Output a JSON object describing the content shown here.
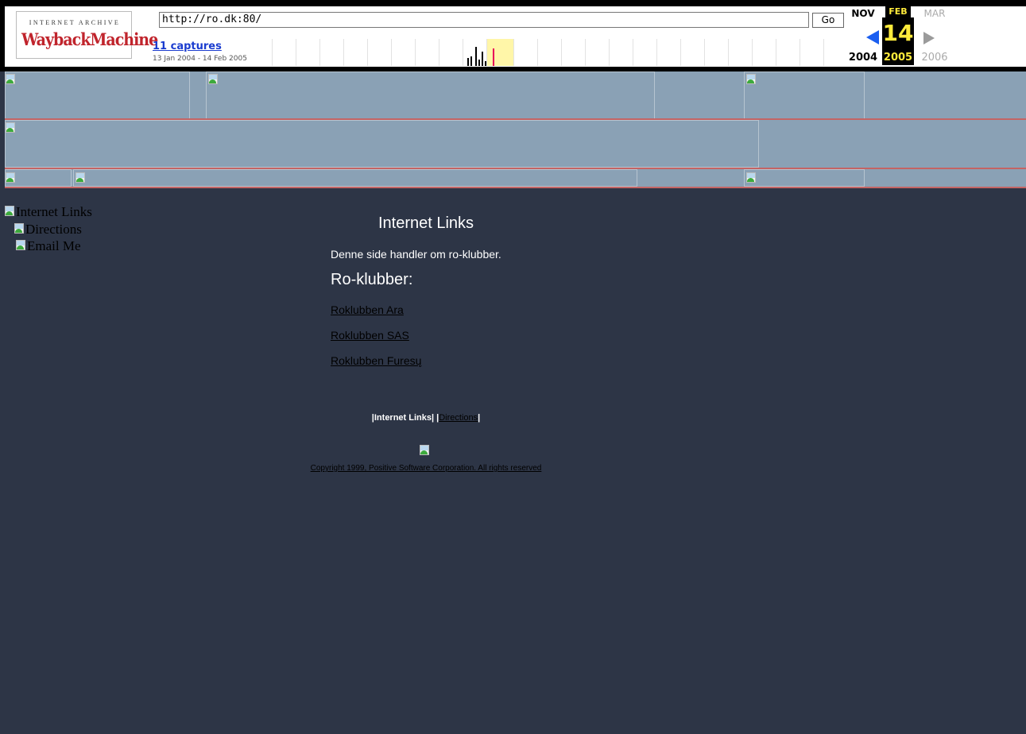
{
  "wayback": {
    "logo_top": "INTERNET ARCHIVE",
    "logo_main": "WaybackMachine",
    "url": "http://ro.dk:80/",
    "go_label": "Go",
    "captures_link": "11 captures",
    "captures_range": "13 Jan 2004 - 14 Feb 2005",
    "prev_month": "NOV",
    "current_month": "FEB",
    "next_month": "MAR",
    "current_day": "14",
    "prev_year": "2004",
    "current_year": "2005",
    "next_year": "2006"
  },
  "left_nav": {
    "items": [
      {
        "alt": "Internet Links"
      },
      {
        "alt": "Directions"
      },
      {
        "alt": "Email Me"
      }
    ]
  },
  "main": {
    "heading": "Internet Links",
    "intro": "Denne side handler om ro-klubber.",
    "clubs_heading": "Ro-klubber:",
    "clubs": [
      {
        "label": "Roklubben Ara"
      },
      {
        "label": "Roklubben SAS"
      },
      {
        "label": "Roklubben Furesų"
      }
    ]
  },
  "footer": {
    "sep_open": "|",
    "internet_links": "Internet Links",
    "sep_mid": "| |",
    "directions": "Directions",
    "sep_close": "|",
    "copyright": "Copyright 1999, Positive Software Corporation. All rights reserved"
  },
  "colors": {
    "page_bg": "#2d3546",
    "band_bg": "#8aa1b5",
    "band_line": "#c46464",
    "calendar_highlight": "#ffeb3b",
    "captures_link": "#1a3ccf"
  }
}
